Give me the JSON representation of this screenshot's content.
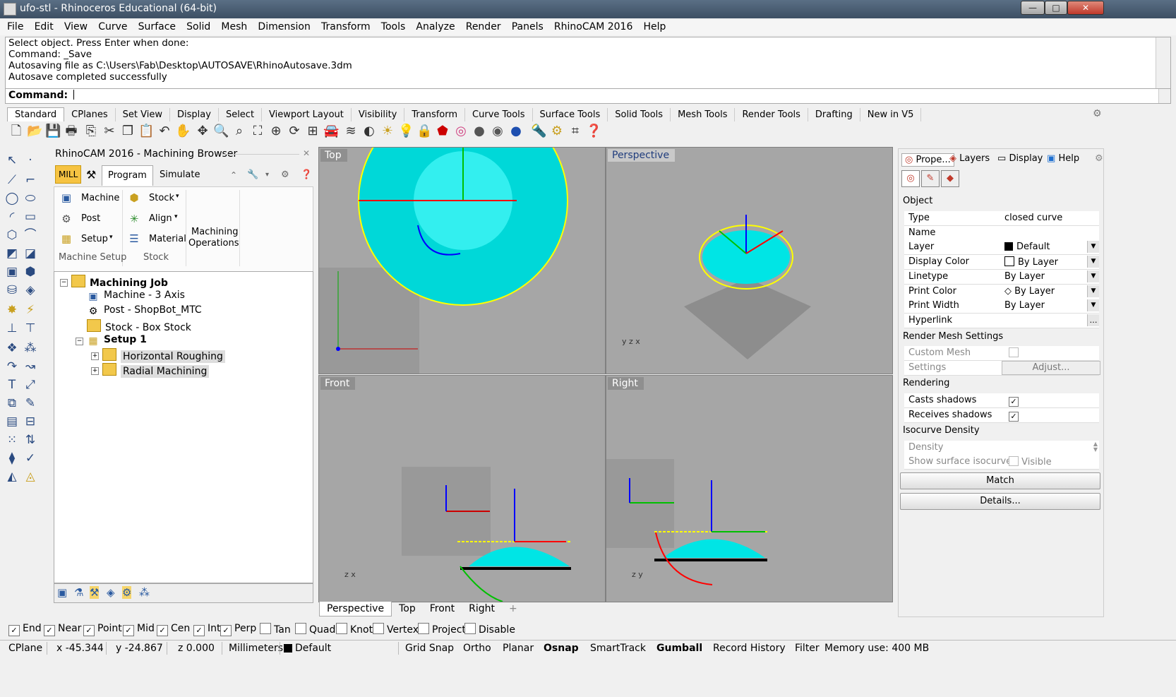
{
  "window": {
    "title": "ufo-stl - Rhinoceros Educational (64-bit)",
    "minimize": "—",
    "maximize": "□",
    "close": "✕"
  },
  "menu": [
    "File",
    "Edit",
    "View",
    "Curve",
    "Surface",
    "Solid",
    "Mesh",
    "Dimension",
    "Transform",
    "Tools",
    "Analyze",
    "Render",
    "Panels",
    "RhinoCAM 2016",
    "Help"
  ],
  "command_history": [
    "Select object. Press Enter when done:",
    "Command: _Save",
    "Autosaving file as C:\\Users\\Fab\\Desktop\\AUTOSAVE\\RhinoAutosave.3dm",
    "Autosave completed successfully"
  ],
  "command_prompt": "Command:",
  "toolbar_tabs": [
    "Standard",
    "CPlanes",
    "Set View",
    "Display",
    "Select",
    "Viewport Layout",
    "Visibility",
    "Transform",
    "Curve Tools",
    "Surface Tools",
    "Solid Tools",
    "Mesh Tools",
    "Render Tools",
    "Drafting",
    "New in V5"
  ],
  "toolbar_icons": [
    "new-icon",
    "open-icon",
    "save-icon",
    "print-icon",
    "import-icon",
    "cut-icon",
    "copy-icon",
    "paste-icon",
    "undo-icon",
    "pan-icon",
    "move-icon",
    "zoom-icon",
    "zoom-window-icon",
    "zoom-extents-icon",
    "zoom-selected-icon",
    "rotate-view-icon",
    "four-view-icon",
    "car-icon",
    "layer-icon",
    "hide-icon",
    "light-icon",
    "lightbulb-icon",
    "lock-icon",
    "material-icon",
    "color-wheel-icon",
    "sphere-icon",
    "render-icon",
    "blue-sphere-icon",
    "flashlight-icon",
    "settings-gear-icon",
    "dimension-icon",
    "help-icon"
  ],
  "browser": {
    "title": "RhinoCAM 2016 - Machining Browser",
    "mill_tab": "MILL",
    "tabs": [
      "Program",
      "Simulate"
    ],
    "ribbon": {
      "machine": "Machine",
      "post": "Post",
      "setup": "Setup",
      "stock": "Stock",
      "align": "Align",
      "material": "Material",
      "ops_line1": "Machining",
      "ops_line2": "Operations",
      "group_machine_setup": "Machine Setup",
      "group_stock": "Stock"
    },
    "tree": {
      "root": "Machining Job",
      "machine": "Machine - 3 Axis",
      "post": "Post - ShopBot_MTC",
      "stock": "Stock - Box Stock",
      "setup": "Setup 1",
      "op1": "Horizontal Roughing",
      "op2": "Radial Machining"
    }
  },
  "viewports": {
    "top": "Top",
    "perspective": "Perspective",
    "front": "Front",
    "right": "Right",
    "active": "Perspective"
  },
  "viewport_tabs": [
    "Perspective",
    "Top",
    "Front",
    "Right"
  ],
  "viewport_tab_add": "+",
  "properties": {
    "tabs": [
      "Prope...",
      "Layers",
      "Display",
      "Help"
    ],
    "object_header": "Object",
    "rows": [
      {
        "key": "Type",
        "value": "closed curve"
      },
      {
        "key": "Name",
        "value": ""
      },
      {
        "key": "Layer",
        "value": "Default"
      },
      {
        "key": "Display Color",
        "value": "By Layer"
      },
      {
        "key": "Linetype",
        "value": "By Layer"
      },
      {
        "key": "Print Color",
        "value": "By Layer"
      },
      {
        "key": "Print Width",
        "value": "By Layer"
      },
      {
        "key": "Hyperlink",
        "value": ""
      }
    ],
    "render_mesh_header": "Render Mesh Settings",
    "custom_mesh": "Custom Mesh",
    "settings": "Settings",
    "adjust_button": "Adjust...",
    "rendering_header": "Rendering",
    "casts_shadows": "Casts shadows",
    "receives_shadows": "Receives shadows",
    "isocurve_header": "Isocurve Density",
    "density": "Density",
    "show_isocurve": "Show surface isocurve",
    "visible": "Visible",
    "match_button": "Match",
    "details_button": "Details..."
  },
  "osnap": [
    {
      "label": "End",
      "checked": true
    },
    {
      "label": "Near",
      "checked": true
    },
    {
      "label": "Point",
      "checked": true
    },
    {
      "label": "Mid",
      "checked": true
    },
    {
      "label": "Cen",
      "checked": true
    },
    {
      "label": "Int",
      "checked": true
    },
    {
      "label": "Perp",
      "checked": true
    },
    {
      "label": "Tan",
      "checked": false
    },
    {
      "label": "Quad",
      "checked": false
    },
    {
      "label": "Knot",
      "checked": false
    },
    {
      "label": "Vertex",
      "checked": false
    },
    {
      "label": "Project",
      "checked": false
    },
    {
      "label": "Disable",
      "checked": false
    }
  ],
  "status": {
    "cplane": "CPlane",
    "x": "x -45.344",
    "y": "y -24.867",
    "z": "z 0.000",
    "units": "Millimeters",
    "layer": "Default",
    "grid_snap": "Grid Snap",
    "ortho": "Ortho",
    "planar": "Planar",
    "osnap": "Osnap",
    "smarttrack": "SmartTrack",
    "gumball": "Gumball",
    "record_history": "Record History",
    "filter": "Filter",
    "memory": "Memory use: 400 MB"
  },
  "colors": {
    "viewport_bg": "#a6a6a6",
    "mesh": "#00ffff",
    "axis_x": "#ff0000",
    "axis_y": "#00c000",
    "axis_z": "#0000ff",
    "highlight": "#ffff00"
  }
}
